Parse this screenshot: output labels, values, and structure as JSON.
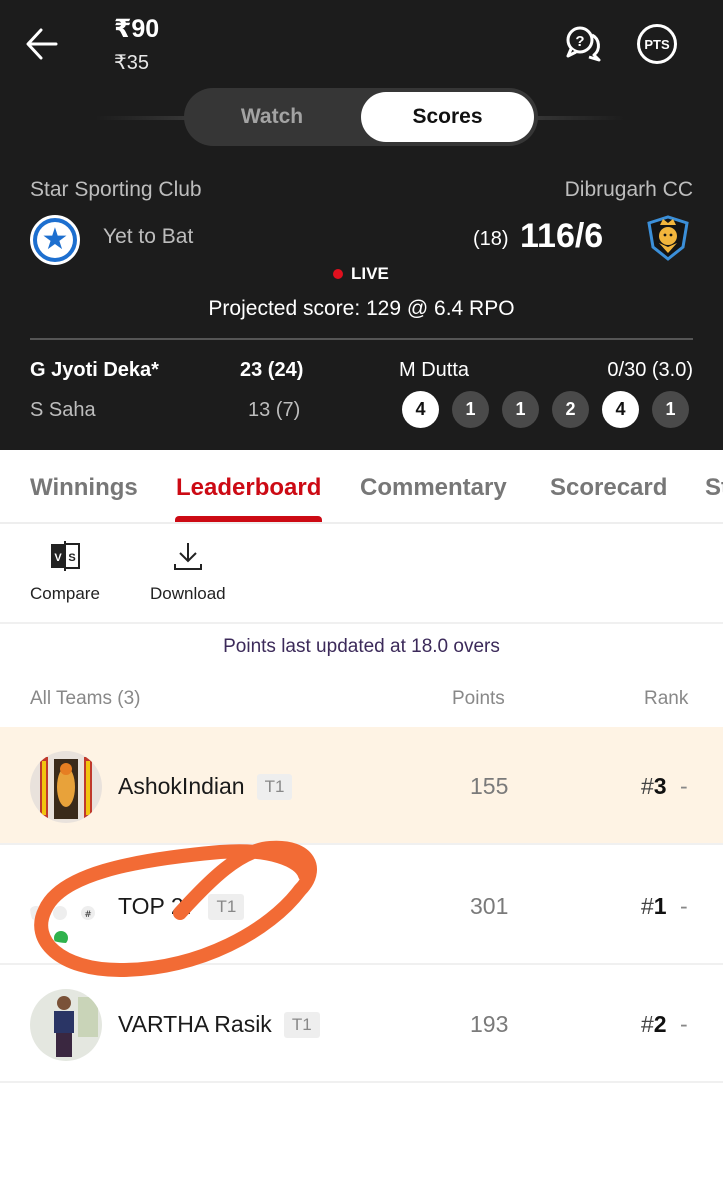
{
  "header": {
    "price_main": "₹90",
    "price_sub": "₹35",
    "icons": {
      "back": "arrow-left-icon",
      "help": "help-chat-icon",
      "points": "pts-icon"
    },
    "pts_label": "PTS",
    "toggle": {
      "options": [
        "Watch",
        "Scores"
      ],
      "selected": "Scores"
    }
  },
  "match": {
    "team_left": {
      "name": "Star Sporting Club",
      "status": "Yet to Bat"
    },
    "team_right": {
      "name": "Dibrugarh CC",
      "overs": "(18)",
      "score": "116/6"
    },
    "live_label": "LIVE",
    "projected": "Projected score: 129 @ 6.4 RPO",
    "batters": [
      {
        "name": "G Jyoti Deka*",
        "score": "23 (24)"
      },
      {
        "name": "S Saha",
        "score": "13 (7)"
      }
    ],
    "bowler": {
      "name": "M Dutta",
      "figures": "0/30 (3.0)"
    },
    "recent_balls": [
      "4",
      "1",
      "1",
      "2",
      "4",
      "1"
    ],
    "colors": {
      "live_dot": "#e0101e",
      "header_bg": "#1c1c1c"
    }
  },
  "tabs": {
    "items": [
      "Winnings",
      "Leaderboard",
      "Commentary",
      "Scorecard",
      "St"
    ],
    "active": "Leaderboard",
    "accent": "#cc0a14"
  },
  "actions": {
    "compare": "Compare",
    "download": "Download",
    "vs_glyph": "VS"
  },
  "leaderboard": {
    "updated": "Points last updated at 18.0 overs",
    "headers": {
      "teams": "All Teams (3)",
      "points": "Points",
      "rank": "Rank"
    },
    "rows": [
      {
        "name": "AshokIndian",
        "badge": "T1",
        "points": "155",
        "rank_hash": "#",
        "rank": "3",
        "trend": "-",
        "highlight": true
      },
      {
        "name": "TOP 27",
        "badge": "T1",
        "points": "301",
        "rank_hash": "#",
        "rank": "1",
        "trend": "-",
        "highlight": false
      },
      {
        "name": "VARTHA Rasik",
        "badge": "T1",
        "points": "193",
        "rank_hash": "#",
        "rank": "2",
        "trend": "-",
        "highlight": false
      }
    ]
  }
}
